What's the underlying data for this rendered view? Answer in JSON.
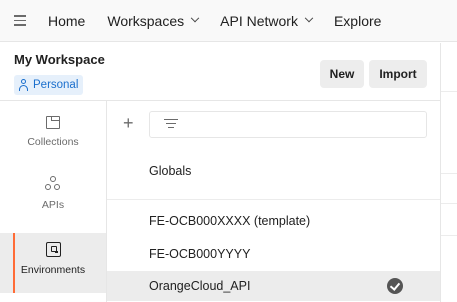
{
  "topnav": {
    "items": [
      {
        "label": "Home",
        "has_dropdown": false
      },
      {
        "label": "Workspaces",
        "has_dropdown": true
      },
      {
        "label": "API Network",
        "has_dropdown": true
      },
      {
        "label": "Explore",
        "has_dropdown": false
      }
    ]
  },
  "workspace": {
    "name": "My Workspace",
    "visibility": "Personal",
    "new_label": "New",
    "import_label": "Import"
  },
  "sidebar": {
    "items": [
      {
        "label": "Collections",
        "icon": "collections-icon",
        "active": false
      },
      {
        "label": "APIs",
        "icon": "apis-icon",
        "active": false
      },
      {
        "label": "Environments",
        "icon": "environments-icon",
        "active": true
      }
    ]
  },
  "environments": {
    "globals_label": "Globals",
    "items": [
      {
        "name": "FE-OCB000XXXX (template)",
        "active": false
      },
      {
        "name": "FE-OCB000YYYY",
        "active": false
      },
      {
        "name": "OrangeCloud_API",
        "active": true
      }
    ]
  },
  "colors": {
    "accent": "#ff6c37",
    "link": "#1b6fcd",
    "selected_bg": "#ececec"
  }
}
